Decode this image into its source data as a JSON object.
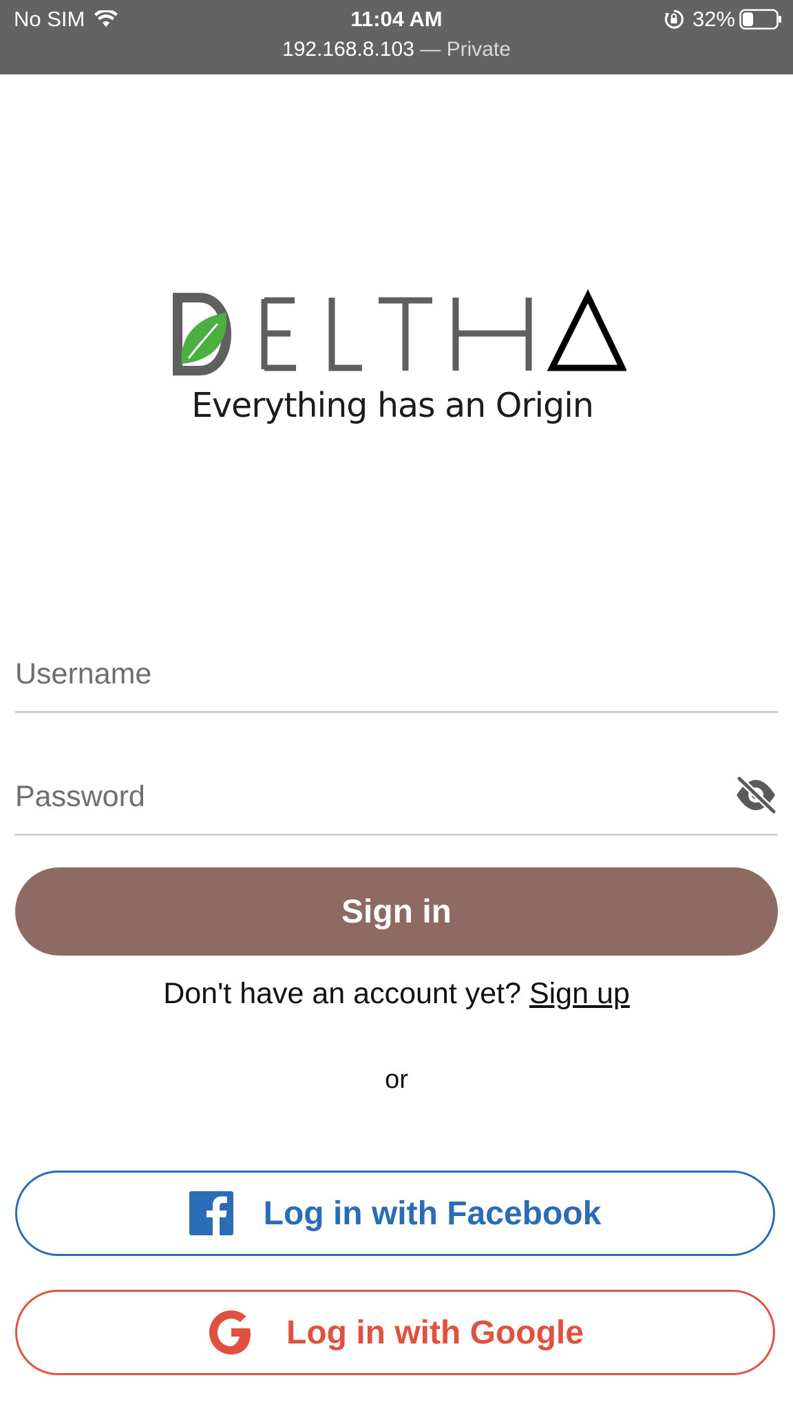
{
  "status_bar": {
    "carrier": "No SIM",
    "time": "11:04 AM",
    "url": "192.168.8.103",
    "url_separator": "—",
    "mode": "Private",
    "battery": "32%",
    "battery_level": 0.32,
    "icons": [
      "wifi-icon",
      "orientation-lock-icon",
      "battery-icon"
    ]
  },
  "logo": {
    "wordmark": "DELTHA",
    "tagline": "Everything has an Origin",
    "colors": {
      "letters": "#5f5f5f",
      "leaf": "#4caf3f",
      "delta": "#000000"
    }
  },
  "form": {
    "username_placeholder": "Username",
    "password_placeholder": "Password",
    "password_toggle_icon": "eye-slash-icon",
    "signin_label": "Sign in"
  },
  "signup": {
    "prompt": "Don't have an account yet?",
    "link": "Sign up"
  },
  "divider_text": "or",
  "social": {
    "facebook_label": "Log in with Facebook",
    "google_label": "Log in with Google",
    "facebook_color": "#2a6db6",
    "google_color": "#e0523f"
  },
  "colors": {
    "status_bar": "#636363",
    "signin_button": "#8d6b62"
  }
}
